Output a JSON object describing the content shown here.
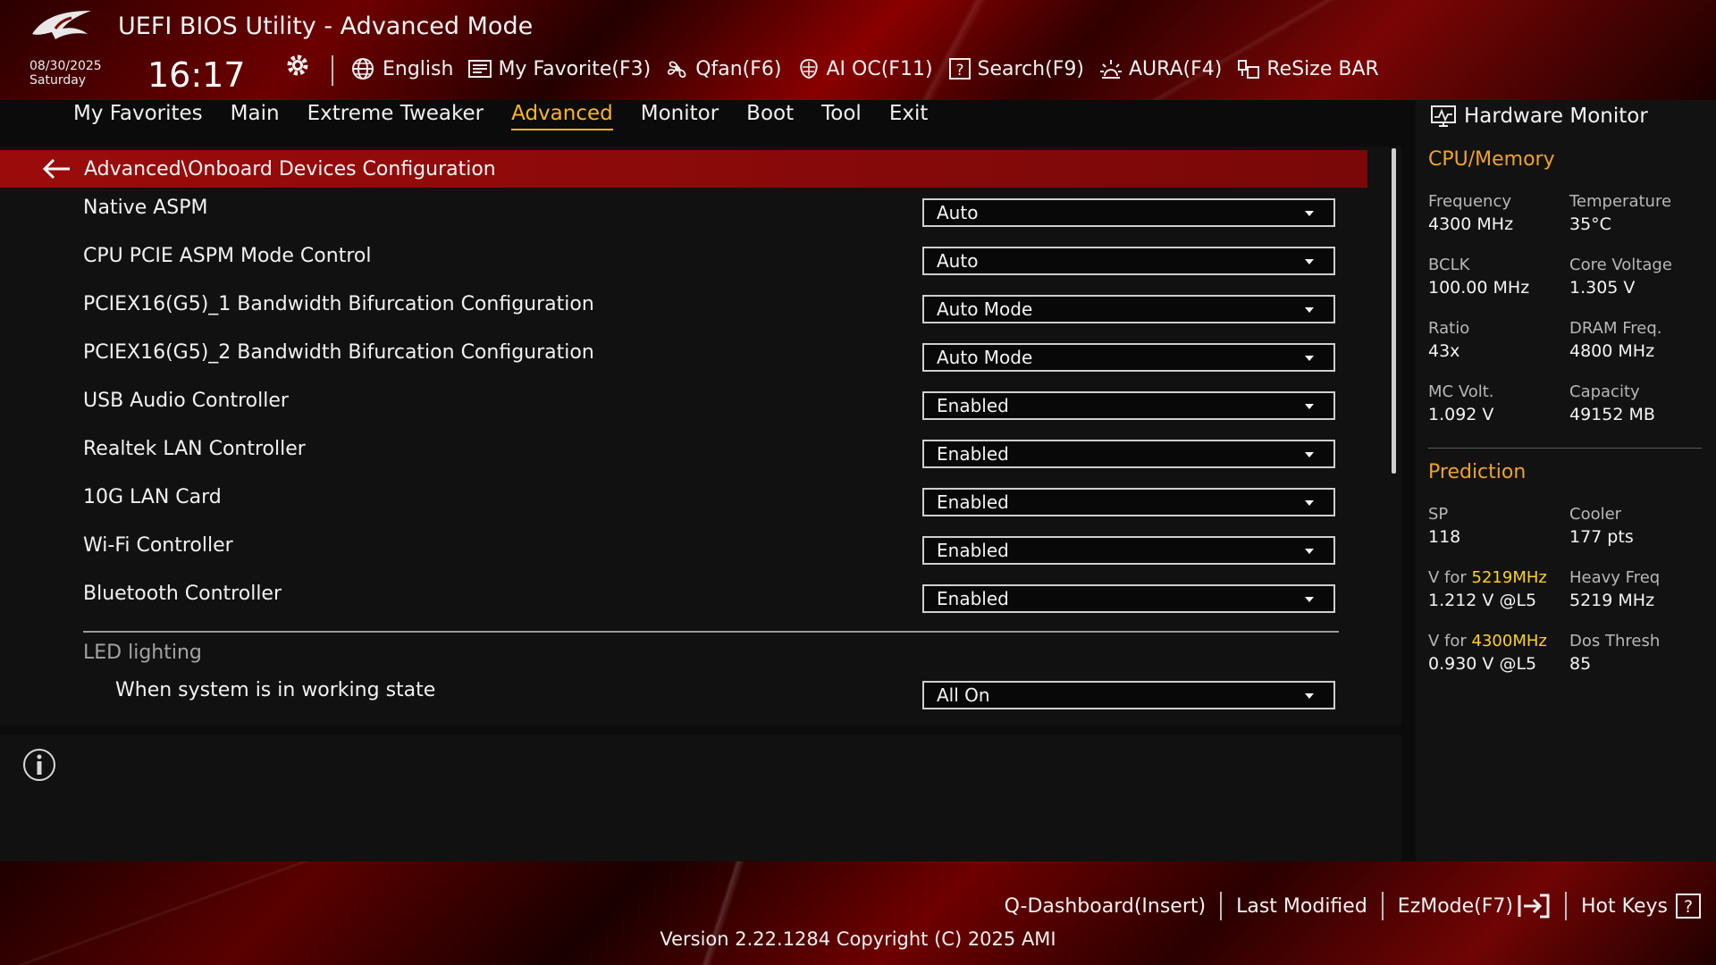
{
  "header": {
    "title": "UEFI BIOS Utility - Advanced Mode",
    "date": "08/30/2025",
    "day": "Saturday",
    "time": "16:17"
  },
  "toolbar": [
    {
      "icon": "globe-icon",
      "label": "English"
    },
    {
      "icon": "favorites-icon",
      "label": "My Favorite(F3)"
    },
    {
      "icon": "fan-icon",
      "label": "Qfan(F6)"
    },
    {
      "icon": "ai-chip-icon",
      "label": "AI OC(F11)"
    },
    {
      "icon": "help-search-icon",
      "label": "Search(F9)"
    },
    {
      "icon": "aura-light-icon",
      "label": "AURA(F4)"
    },
    {
      "icon": "resize-bar-icon",
      "label": "ReSize BAR"
    }
  ],
  "tabs": [
    {
      "label": "My Favorites",
      "active": false
    },
    {
      "label": "Main",
      "active": false
    },
    {
      "label": "Extreme Tweaker",
      "active": false
    },
    {
      "label": "Advanced",
      "active": true
    },
    {
      "label": "Monitor",
      "active": false
    },
    {
      "label": "Boot",
      "active": false
    },
    {
      "label": "Tool",
      "active": false
    },
    {
      "label": "Exit",
      "active": false
    }
  ],
  "breadcrumb": "Advanced\\Onboard Devices Configuration",
  "settings": [
    {
      "label": "Native ASPM",
      "value": "Auto"
    },
    {
      "label": "CPU PCIE ASPM Mode Control",
      "value": "Auto"
    },
    {
      "label": "PCIEX16(G5)_1 Bandwidth Bifurcation Configuration",
      "value": "Auto Mode"
    },
    {
      "label": "PCIEX16(G5)_2 Bandwidth Bifurcation Configuration",
      "value": "Auto Mode"
    },
    {
      "label": "USB Audio Controller",
      "value": "Enabled"
    },
    {
      "label": "Realtek LAN Controller",
      "value": "Enabled"
    },
    {
      "label": "10G LAN Card",
      "value": "Enabled"
    },
    {
      "label": "Wi-Fi Controller",
      "value": "Enabled"
    },
    {
      "label": "Bluetooth Controller",
      "value": "Enabled"
    }
  ],
  "led": {
    "heading": "LED lighting",
    "working_state_label": "When system is in working state",
    "working_state_value": "All On"
  },
  "hardware_monitor": {
    "title": "Hardware Monitor",
    "cpu_memory": {
      "heading": "CPU/Memory",
      "items": [
        {
          "key": "Frequency",
          "value": "4300 MHz"
        },
        {
          "key": "Temperature",
          "value": "35°C"
        },
        {
          "key": "BCLK",
          "value": "100.00 MHz"
        },
        {
          "key": "Core Voltage",
          "value": "1.305 V"
        },
        {
          "key": "Ratio",
          "value": "43x"
        },
        {
          "key": "DRAM Freq.",
          "value": "4800 MHz"
        },
        {
          "key": "MC Volt.",
          "value": "1.092 V"
        },
        {
          "key": "Capacity",
          "value": "49152 MB"
        }
      ]
    },
    "prediction": {
      "heading": "Prediction",
      "items": [
        {
          "key": "SP",
          "value": "118"
        },
        {
          "key": "Cooler",
          "value": "177 pts"
        },
        {
          "key_prefix": "V for ",
          "key_highlight": "5219MHz",
          "value": "1.212 V @L5"
        },
        {
          "key": "Heavy Freq",
          "value": "5219 MHz"
        },
        {
          "key_prefix": "V for ",
          "key_highlight": "4300MHz",
          "value": "0.930 V @L5"
        },
        {
          "key": "Dos Thresh",
          "value": "85"
        }
      ]
    }
  },
  "footer": {
    "q_dashboard": "Q-Dashboard(Insert)",
    "last_modified": "Last Modified",
    "ezmode": "EzMode(F7)",
    "hot_keys": "Hot Keys",
    "version": "Version 2.22.1284 Copyright (C) 2025 AMI"
  },
  "colors": {
    "accent": "#ffb429",
    "section": "#f0a22a",
    "highlight": "#ffd21a",
    "breadcrumb_bg": "#9c0b0b"
  }
}
